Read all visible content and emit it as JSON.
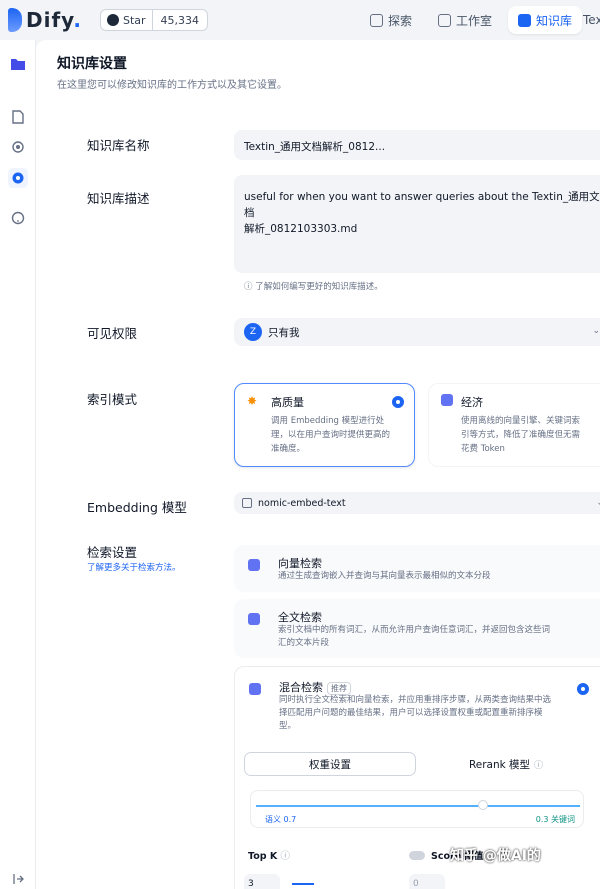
{
  "header": {
    "logo": "Dify",
    "logo_dot": ".",
    "github_star": "Star",
    "github_count": "45,334",
    "nav": [
      "探索",
      "工作室",
      "知识库"
    ],
    "nav_overflow": "Tex"
  },
  "page": {
    "title": "知识库设置",
    "subtitle": "在这里您可以修改知识库的工作方式以及其它设置。"
  },
  "name": {
    "label": "知识库名称",
    "value": "Textin_通用文档解析_0812..."
  },
  "description": {
    "label": "知识库描述",
    "value_line1": "useful for when you want to answer queries about the Textin_通用文档",
    "value_line2": "解析_0812103303.md",
    "hint": "了解如何编写更好的知识库描述。"
  },
  "permission": {
    "label": "可见权限",
    "avatar": "Z",
    "value": "只有我"
  },
  "index_mode": {
    "label": "索引模式",
    "high": {
      "title": "高质量",
      "desc1": "调用 Embedding 模型进行处",
      "desc2": "理，以在用户查询时提供更高的",
      "desc3": "准确度。"
    },
    "eco": {
      "title": "经济",
      "desc1": "使用离线的向量引擎、关键词索",
      "desc2": "引等方式，降低了准确度但无需",
      "desc3": "花费 Token"
    }
  },
  "embedding": {
    "label": "Embedding 模型",
    "value": "nomic-embed-text"
  },
  "retrieval": {
    "label": "检索设置",
    "link": "了解更多关于检索方法。",
    "vector": {
      "title": "向量检索",
      "desc1": "通过生成查询嵌入并查询与其向量表示最相似的文本分段"
    },
    "fulltext": {
      "title": "全文检索",
      "desc1": "索引文档中的所有词汇，从而允许用户查询任意词汇，并返回包含这些词",
      "desc2": "汇的文本片段"
    },
    "hybrid": {
      "title": "混合检索",
      "tag": "推荐",
      "desc1": "同时执行全文检索和向量检索，并应用重排序步骤，从两类查询结果中选",
      "desc2": "择匹配用户问题的最佳结果，用户可以选择设置权重或配置重新排序模",
      "desc3": "型。"
    },
    "weight_tab": "权重设置",
    "rerank_tab": "Rerank 模型",
    "semantic_label": "语义 0.7",
    "keyword_label": "0.3 关键词",
    "semantic_weight": 0.7,
    "topk_label": "Top K",
    "topk_value": "3",
    "score_label": "Score 阈值",
    "score_value": "0"
  },
  "watermark": "知乎 @做AI的"
}
